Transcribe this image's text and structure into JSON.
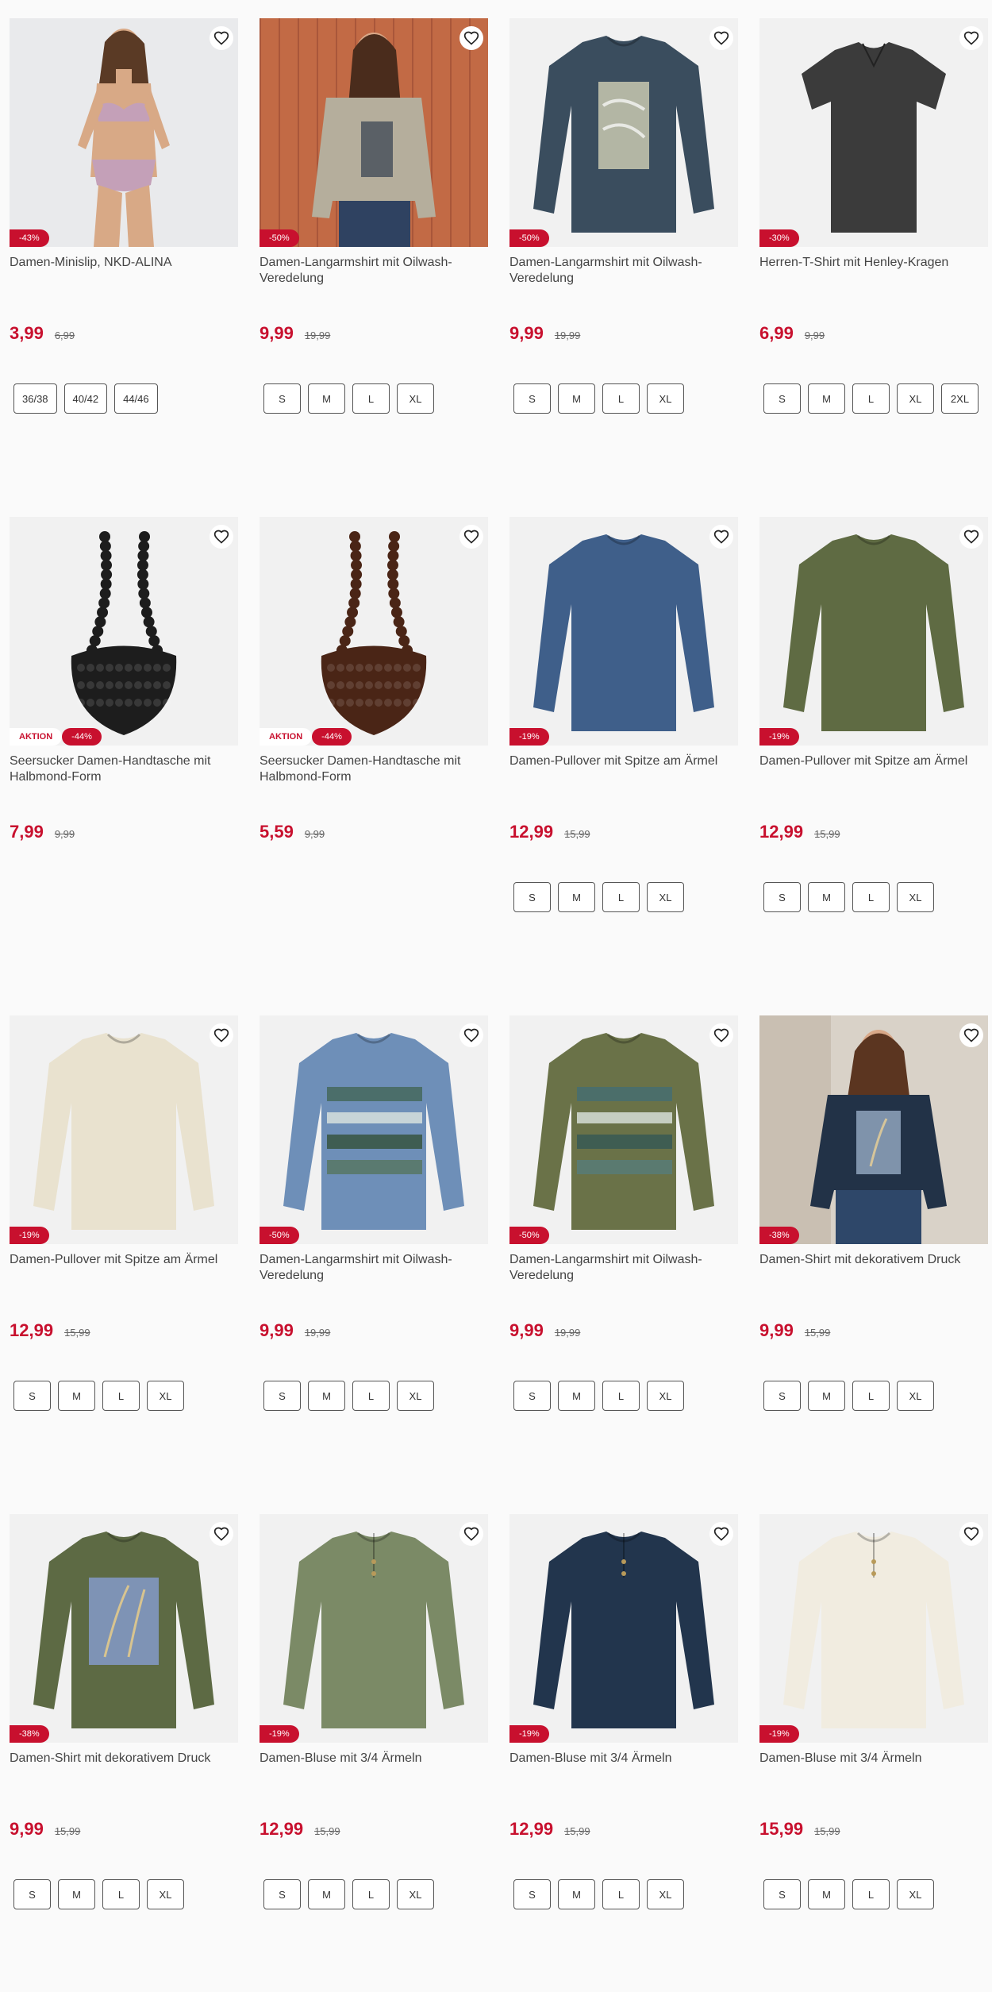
{
  "colors": {
    "accent": "#c8102e",
    "background": "#fafafa"
  },
  "products": [
    {
      "title": "Damen-Minislip, NKD-ALINA",
      "price": "3,99",
      "old_price": "6,99",
      "discount": "-43%",
      "aktion": "",
      "sizes": [
        "36/38",
        "40/42",
        "44/46"
      ],
      "image": "model-underwear"
    },
    {
      "title": "Damen-Langarmshirt mit Oilwash-Veredelung",
      "price": "9,99",
      "old_price": "19,99",
      "discount": "-50%",
      "aktion": "",
      "sizes": [
        "S",
        "M",
        "L",
        "XL"
      ],
      "image": "model-beige-shirt"
    },
    {
      "title": "Damen-Langarmshirt mit Oilwash-Veredelung",
      "price": "9,99",
      "old_price": "19,99",
      "discount": "-50%",
      "aktion": "",
      "sizes": [
        "S",
        "M",
        "L",
        "XL"
      ],
      "image": "navy-print-shirt"
    },
    {
      "title": "Herren-T-Shirt mit Henley-Kragen",
      "price": "6,99",
      "old_price": "9,99",
      "discount": "-30%",
      "aktion": "",
      "sizes": [
        "S",
        "M",
        "L",
        "XL",
        "2XL"
      ],
      "image": "dark-henley-tshirt"
    },
    {
      "title": "Seersucker Damen-Handtasche mit Halbmond-Form",
      "price": "7,99",
      "old_price": "9,99",
      "discount": "-44%",
      "aktion": "AKTION",
      "sizes": [],
      "image": "black-bag"
    },
    {
      "title": "Seersucker Damen-Handtasche mit Halbmond-Form",
      "price": "5,59",
      "old_price": "9,99",
      "discount": "-44%",
      "aktion": "AKTION",
      "sizes": [],
      "image": "brown-bag"
    },
    {
      "title": "Damen-Pullover mit Spitze am Ärmel",
      "price": "12,99",
      "old_price": "15,99",
      "discount": "-19%",
      "aktion": "",
      "sizes": [
        "S",
        "M",
        "L",
        "XL"
      ],
      "image": "blue-pullover"
    },
    {
      "title": "Damen-Pullover mit Spitze am Ärmel",
      "price": "12,99",
      "old_price": "15,99",
      "discount": "-19%",
      "aktion": "",
      "sizes": [
        "S",
        "M",
        "L",
        "XL"
      ],
      "image": "olive-pullover"
    },
    {
      "title": "Damen-Pullover mit Spitze am Ärmel",
      "price": "12,99",
      "old_price": "15,99",
      "discount": "-19%",
      "aktion": "",
      "sizes": [
        "S",
        "M",
        "L",
        "XL"
      ],
      "image": "cream-pullover"
    },
    {
      "title": "Damen-Langarmshirt mit Oilwash-Veredelung",
      "price": "9,99",
      "old_price": "19,99",
      "discount": "-50%",
      "aktion": "",
      "sizes": [
        "S",
        "M",
        "L",
        "XL"
      ],
      "image": "blue-print-shirt"
    },
    {
      "title": "Damen-Langarmshirt mit Oilwash-Veredelung",
      "price": "9,99",
      "old_price": "19,99",
      "discount": "-50%",
      "aktion": "",
      "sizes": [
        "S",
        "M",
        "L",
        "XL"
      ],
      "image": "olive-print-shirt"
    },
    {
      "title": "Damen-Shirt mit dekorativem Druck",
      "price": "9,99",
      "old_price": "15,99",
      "discount": "-38%",
      "aktion": "",
      "sizes": [
        "S",
        "M",
        "L",
        "XL"
      ],
      "image": "model-navy-shirt"
    },
    {
      "title": "Damen-Shirt mit dekorativem Druck",
      "price": "9,99",
      "old_price": "15,99",
      "discount": "-38%",
      "aktion": "",
      "sizes": [
        "S",
        "M",
        "L",
        "XL"
      ],
      "image": "olive-feather-shirt"
    },
    {
      "title": "Damen-Bluse mit 3/4 Ärmeln",
      "price": "12,99",
      "old_price": "15,99",
      "discount": "-19%",
      "aktion": "",
      "sizes": [
        "S",
        "M",
        "L",
        "XL"
      ],
      "image": "olive-blouse"
    },
    {
      "title": "Damen-Bluse mit 3/4 Ärmeln",
      "price": "12,99",
      "old_price": "15,99",
      "discount": "-19%",
      "aktion": "",
      "sizes": [
        "S",
        "M",
        "L",
        "XL"
      ],
      "image": "navy-blouse"
    },
    {
      "title": "Damen-Bluse mit 3/4 Ärmeln",
      "price": "15,99",
      "old_price": "15,99",
      "discount": "-19%",
      "aktion": "",
      "sizes": [
        "S",
        "M",
        "L",
        "XL"
      ],
      "image": "cream-blouse"
    }
  ]
}
